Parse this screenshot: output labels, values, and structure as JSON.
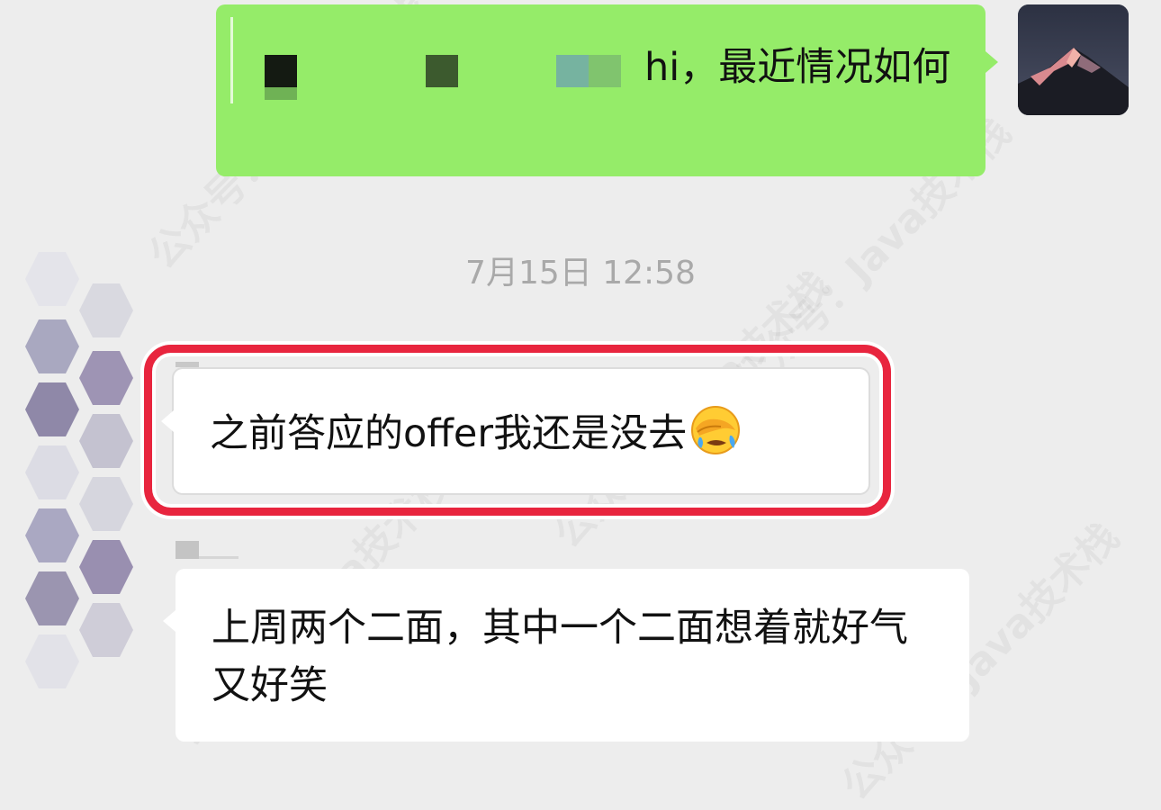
{
  "conversation": {
    "sent_message": {
      "text": "hi，最近情况如何"
    },
    "timestamp": "7月15日 12:58",
    "received_messages": [
      {
        "text": "之前答应的offer我还是没去",
        "emoji": "face-with-hand-over-eye-crying-emoji",
        "highlighted": true
      },
      {
        "text": "上周两个二面，其中一个二面想着就好气又好笑"
      }
    ]
  },
  "watermark": {
    "text": "公众号：Java技术栈"
  },
  "colors": {
    "background": "#ededed",
    "sent_bubble": "#95ec69",
    "received_bubble": "#ffffff",
    "highlight_border": "#e8253e",
    "timestamp_text": "#a9a9a9"
  }
}
